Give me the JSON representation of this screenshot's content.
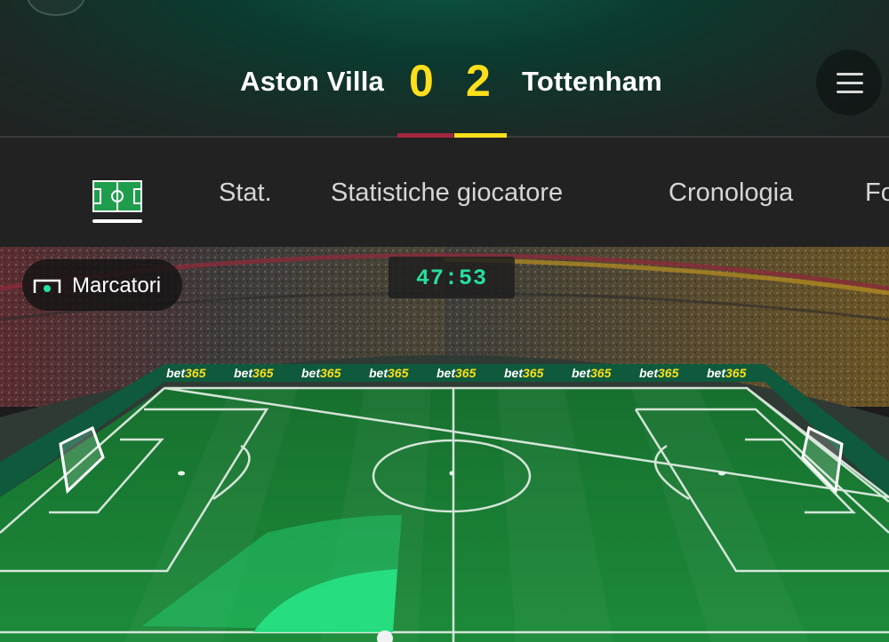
{
  "match": {
    "home_team": "Aston Villa",
    "away_team": "Tottenham",
    "home_score": "0",
    "away_score": "2",
    "home_color": "#a3253f",
    "away_color": "#ffdf1b"
  },
  "header": {
    "back_icon": "back-arrow-icon",
    "menu_icon": "hamburger-menu-icon"
  },
  "tabs": [
    {
      "label": "",
      "icon": "pitch-icon",
      "active": true
    },
    {
      "label": "Stat.",
      "active": false
    },
    {
      "label": "Statistiche giocatore",
      "active": false
    },
    {
      "label": "Cronologia",
      "active": false
    },
    {
      "label": "Fo",
      "active": false
    }
  ],
  "field": {
    "scorers_button": "Marcatori",
    "clock": "47:53",
    "board_text_a": "bet",
    "board_text_b": "365",
    "accent": "#26e0a0"
  }
}
